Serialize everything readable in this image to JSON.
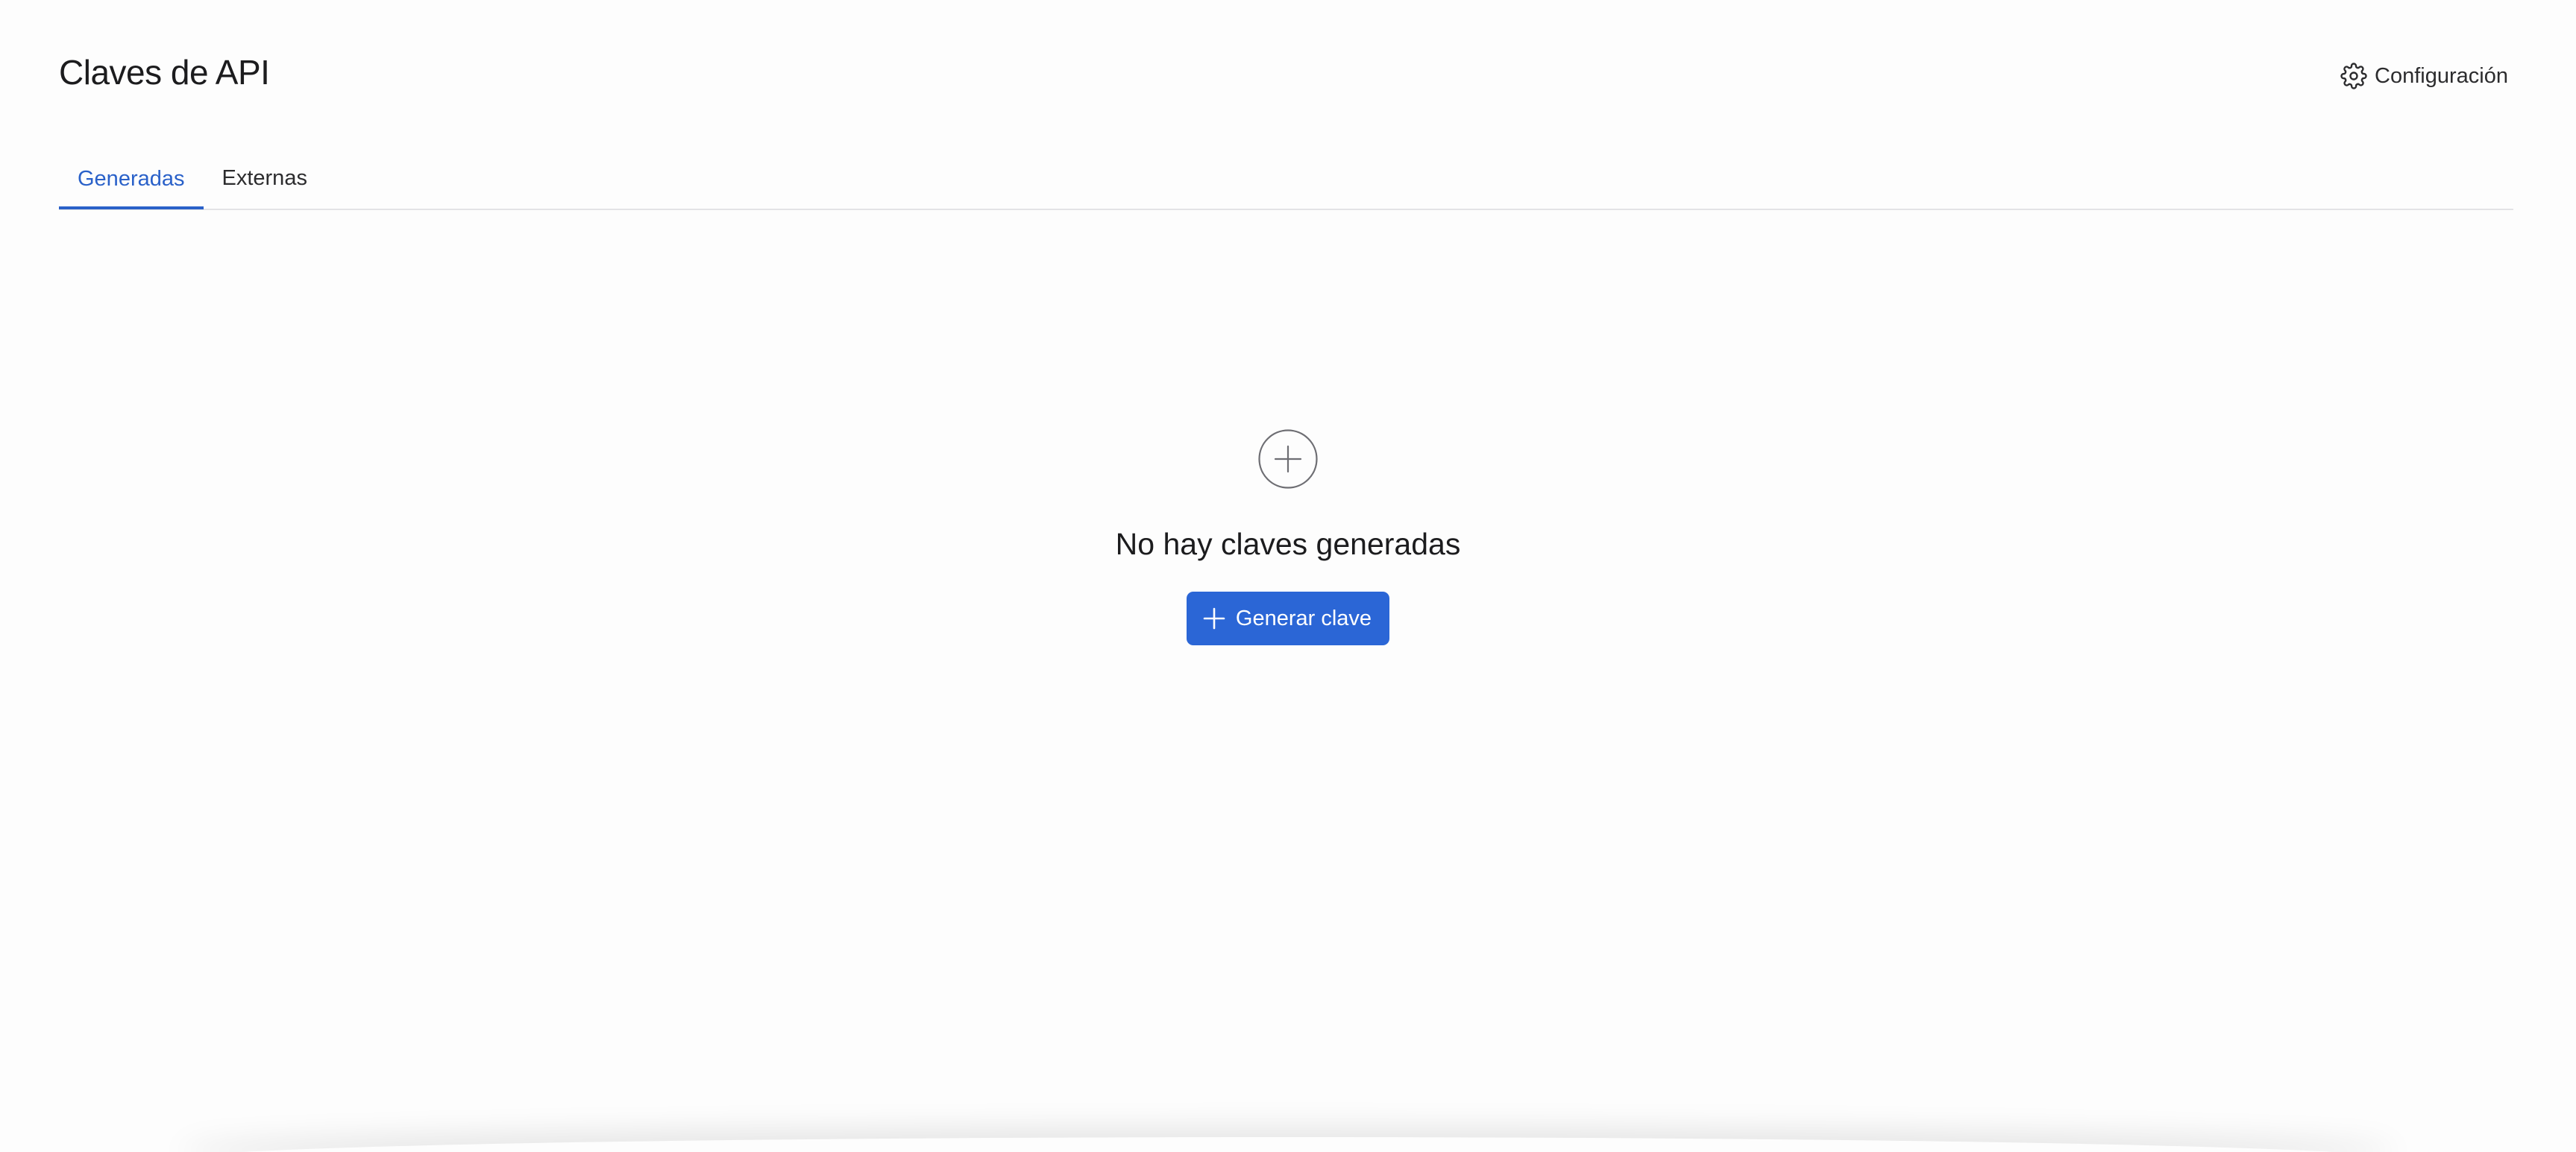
{
  "header": {
    "title": "Claves de API",
    "settings_label": "Configuración"
  },
  "tabs": [
    {
      "label": "Generadas",
      "active": true
    },
    {
      "label": "Externas",
      "active": false
    }
  ],
  "empty_state": {
    "icon": "plus-circle-icon",
    "message": "No hay claves generadas",
    "button_label": "Generar clave"
  },
  "colors": {
    "accent": "#2b66d6",
    "active_tab": "#2a61c9",
    "background": "#fdfdfd"
  }
}
